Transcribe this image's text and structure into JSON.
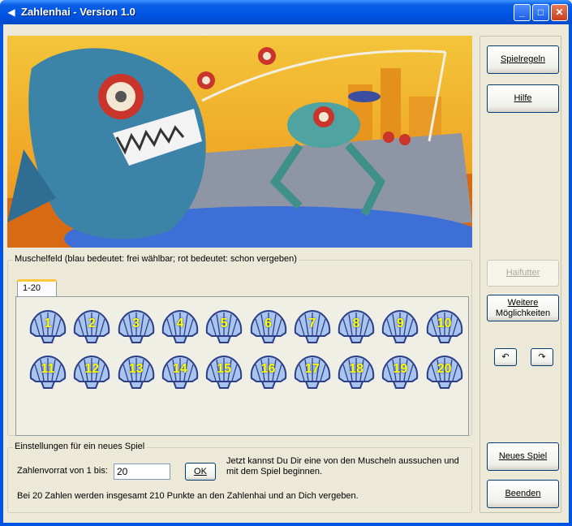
{
  "window": {
    "title": "Zahlenhai - Version 1.0",
    "app_icon": "shark-icon",
    "controls": [
      "minimize",
      "maximize",
      "close"
    ]
  },
  "muschelfeld": {
    "legend": "Muschelfeld  (blau bedeutet: frei wählbar;  rot bedeutet: schon vergeben)",
    "tabs": [
      {
        "label": "1-20",
        "selected": true
      }
    ],
    "shells": [
      "1",
      "2",
      "3",
      "4",
      "5",
      "6",
      "7",
      "8",
      "9",
      "10",
      "11",
      "12",
      "13",
      "14",
      "15",
      "16",
      "17",
      "18",
      "19",
      "20"
    ],
    "shell_state": "frei wählbar",
    "colors": {
      "shell_fill": "#a9c4ee",
      "shell_stroke": "#2c3f86",
      "number": "#ffff00"
    }
  },
  "einstellungen": {
    "legend": "Einstellungen für ein neues Spiel",
    "zahlenvorrat_label": "Zahlenvorrat von 1 bis:",
    "zahlenvorrat_value": "20",
    "ok_label": "OK",
    "hint": "Jetzt kannst Du Dir eine von den Muscheln aussuchen und mit dem Spiel beginnen.",
    "info": "Bei 20 Zahlen werden insgesamt 210 Punkte an den Zahlenhai und an Dich vergeben."
  },
  "sidebar": {
    "spielregeln": "Spielregeln",
    "hilfe": "Hilfe",
    "haifutter": "Haifutter",
    "weitere_1": "Weitere",
    "weitere_2": "Möglichkeiten",
    "undo_icon": "undo-icon",
    "redo_icon": "redo-icon",
    "neues_spiel": "Neues Spiel",
    "beenden": "Beenden"
  }
}
